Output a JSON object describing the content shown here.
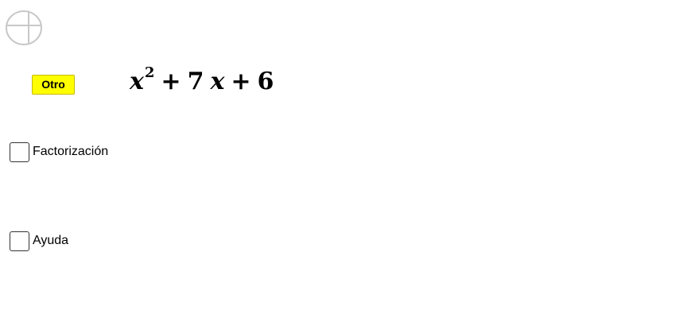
{
  "app": {
    "icon": "geogebra-logo-icon"
  },
  "button": {
    "label": "Otro",
    "color": "#ffff00"
  },
  "expression": {
    "var": "x",
    "exponent": "2",
    "plus1": "+",
    "coef": "7",
    "var2": "x",
    "plus2": "+",
    "const": "6"
  },
  "checkboxes": [
    {
      "label": "Factorización",
      "checked": false
    },
    {
      "label": "Ayuda",
      "checked": false
    }
  ]
}
